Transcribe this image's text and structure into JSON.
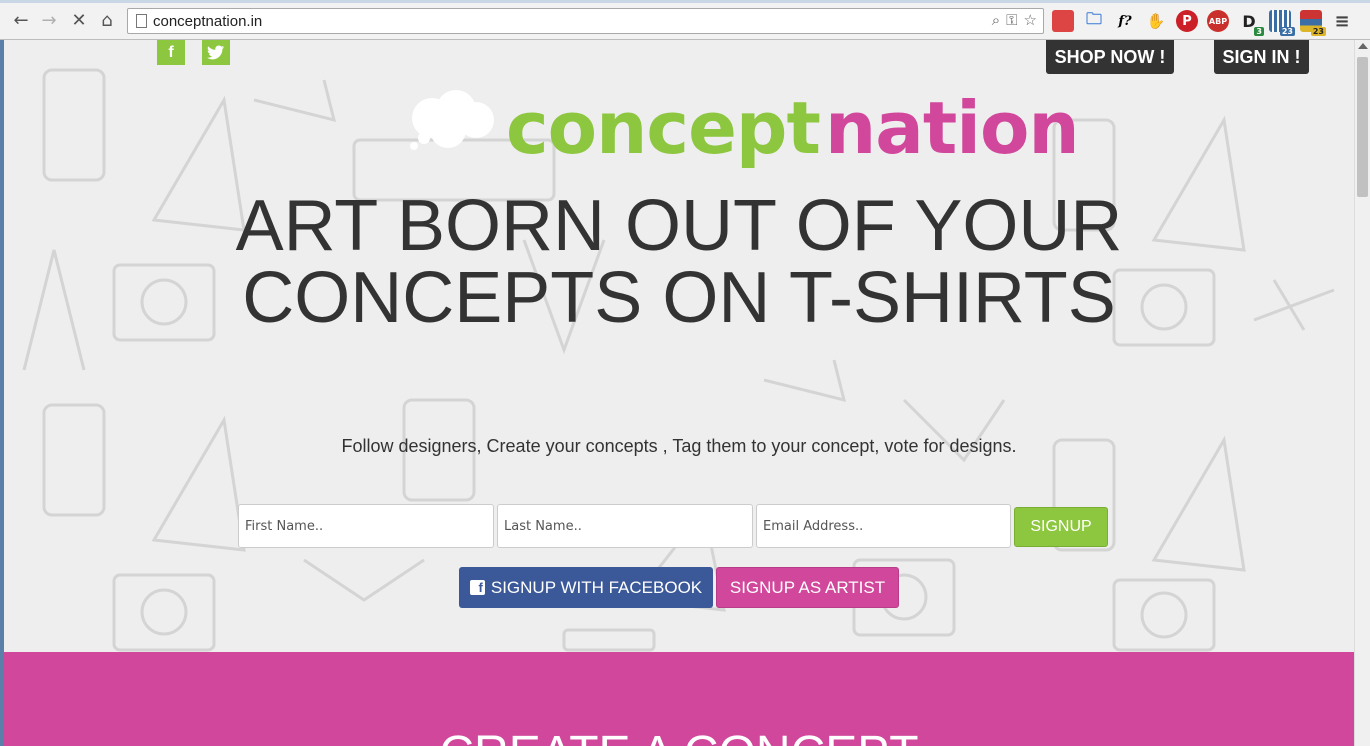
{
  "browser": {
    "url": "conceptnation.in",
    "extensions": [
      "bookmarks-icon",
      "folder-icon",
      "font-icon",
      "evernote-icon",
      "pinterest-icon",
      "adblock-icon",
      "d-icon",
      "extension-grid-icon",
      "extension-tab-icon",
      "menu-icon"
    ],
    "extension_labels": {
      "font": "f?",
      "adblock": "ABP",
      "d": "D",
      "d_badge": "3",
      "grid_badge": "23",
      "tab_badge": "23"
    }
  },
  "social": {
    "facebook": "f",
    "twitter": "t"
  },
  "top_buttons": {
    "shop": "SHOP NOW !",
    "signin": "SIGN IN !"
  },
  "logo": {
    "word1": "concept",
    "word2": "nation",
    "colors": {
      "green": "#8dc63f",
      "pink": "#d1479b"
    }
  },
  "hero": {
    "headline": "ART BORN OUT OF YOUR CONCEPTS ON T-SHIRTS",
    "tagline": "Follow designers, Create your concepts , Tag them to your concept, vote for designs."
  },
  "signup_form": {
    "first_name_placeholder": "First Name..",
    "last_name_placeholder": "Last Name..",
    "email_placeholder": "Email Address..",
    "signup_label": "SIGNUP",
    "facebook_label": "SIGNUP WITH FACEBOOK",
    "artist_label": "SIGNUP AS ARTIST"
  },
  "section": {
    "title": "CREATE A CONCEPT"
  }
}
